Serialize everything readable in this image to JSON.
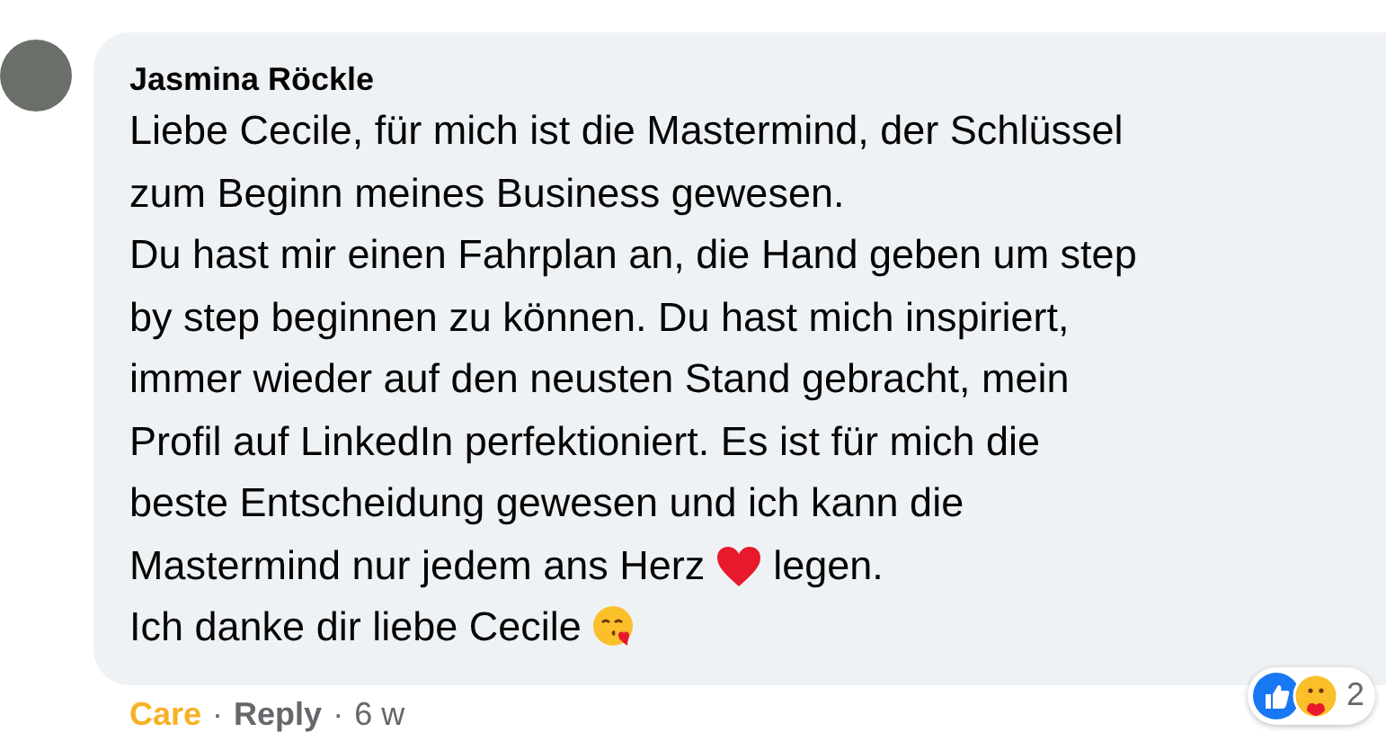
{
  "comment": {
    "author": "Jasmina Röckle",
    "lines": [
      [
        {
          "kind": "text",
          "text": "Liebe Cecile, für mich ist die Mastermind, der Schlüssel"
        }
      ],
      [
        {
          "kind": "text",
          "text": "zum Beginn meines Business gewesen."
        }
      ],
      [
        {
          "kind": "text",
          "text": "Du hast mir einen Fahrplan an, die Hand geben um step"
        }
      ],
      [
        {
          "kind": "text",
          "text": "by step beginnen zu können. Du hast mich inspiriert,"
        }
      ],
      [
        {
          "kind": "text",
          "text": "immer wieder auf den neusten Stand gebracht, mein"
        }
      ],
      [
        {
          "kind": "text",
          "text": "Profil auf LinkedIn perfektioniert. Es ist für mich die"
        }
      ],
      [
        {
          "kind": "text",
          "text": "beste Entscheidung gewesen und ich kann die"
        }
      ],
      [
        {
          "kind": "text",
          "text": "Mastermind nur jedem ans Herz"
        },
        {
          "kind": "heart"
        },
        {
          "kind": "text",
          "text": "legen."
        }
      ],
      [
        {
          "kind": "text",
          "text": "Ich danke dir liebe Cecile"
        },
        {
          "kind": "kiss"
        }
      ]
    ],
    "actions": [
      {
        "label": "Care",
        "reacted": true
      },
      {
        "label": "Reply",
        "reacted": false
      }
    ],
    "separator": "·",
    "age": "6 w",
    "reactions": {
      "count": "2"
    }
  }
}
